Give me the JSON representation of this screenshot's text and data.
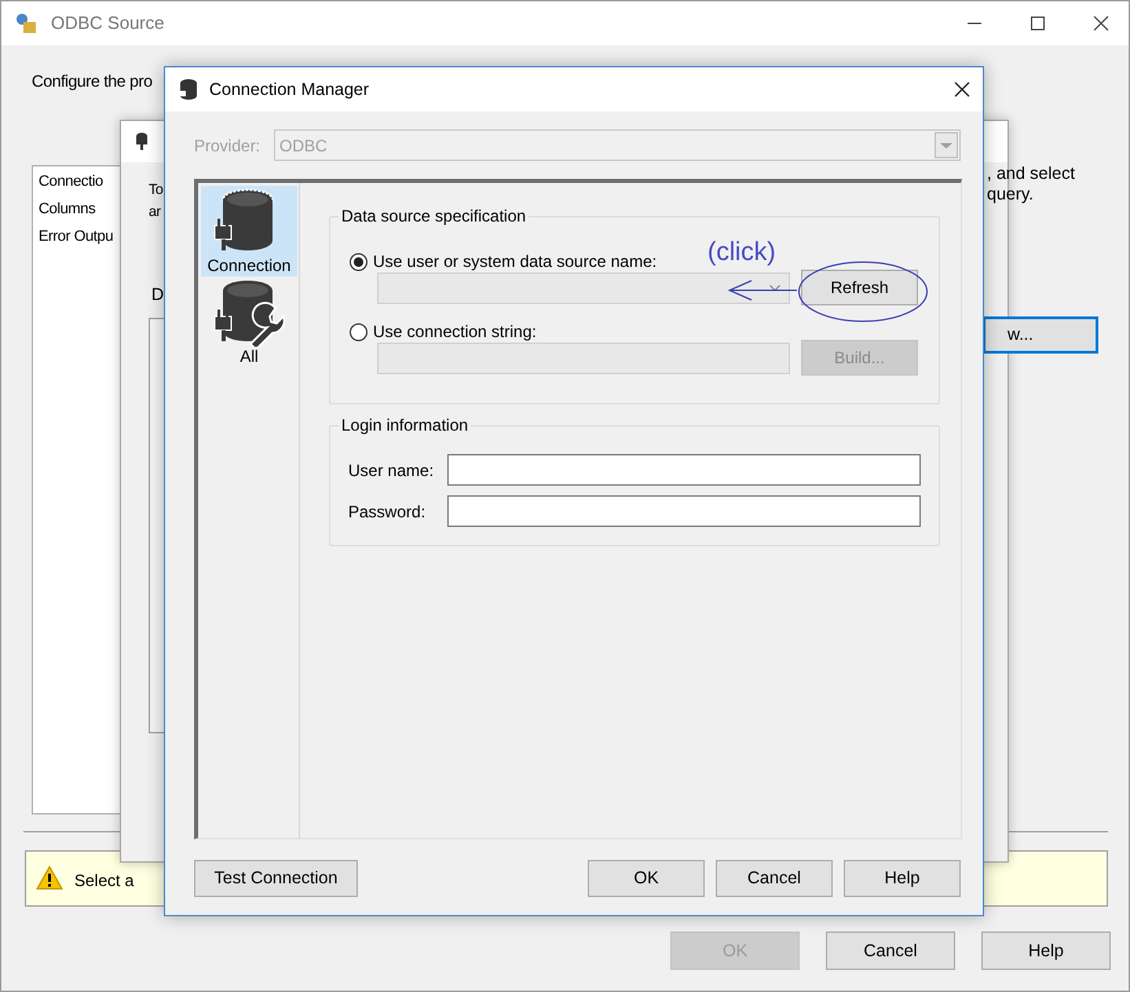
{
  "background_window": {
    "title": "ODBC Source",
    "description": "Configure the pro",
    "pages": [
      "Connectio",
      "Columns",
      "Error Outpu"
    ],
    "side_text": [
      ", and select",
      "query."
    ],
    "preview_button": "w...",
    "warning": "Select a",
    "buttons": [
      {
        "label": "OK",
        "disabled": true
      },
      {
        "label": "Cancel",
        "disabled": false
      },
      {
        "label": "Help",
        "disabled": false
      }
    ]
  },
  "middle_window": {
    "text_fragments": [
      "To",
      "ar",
      "D"
    ]
  },
  "dialog": {
    "title": "Connection Manager",
    "provider": {
      "label": "Provider:",
      "value": "ODBC",
      "disabled": true
    },
    "nav": [
      {
        "label": "Connection",
        "kind": "connection",
        "selected": true
      },
      {
        "label": "All",
        "kind": "all",
        "selected": false
      }
    ],
    "data_source": {
      "title": "Data source specification",
      "options": [
        {
          "label": "Use user or system data source name:",
          "selected": true,
          "button": {
            "label": "Refresh",
            "disabled": false
          }
        },
        {
          "label": "Use connection string:",
          "selected": false,
          "button": {
            "label": "Build...",
            "disabled": true
          }
        }
      ]
    },
    "login": {
      "title": "Login information",
      "fields": [
        "User name:",
        "Password:"
      ]
    },
    "test_button": "Test Connection",
    "buttons": [
      "OK",
      "Cancel",
      "Help"
    ]
  },
  "annotation": {
    "text": "(click)"
  }
}
